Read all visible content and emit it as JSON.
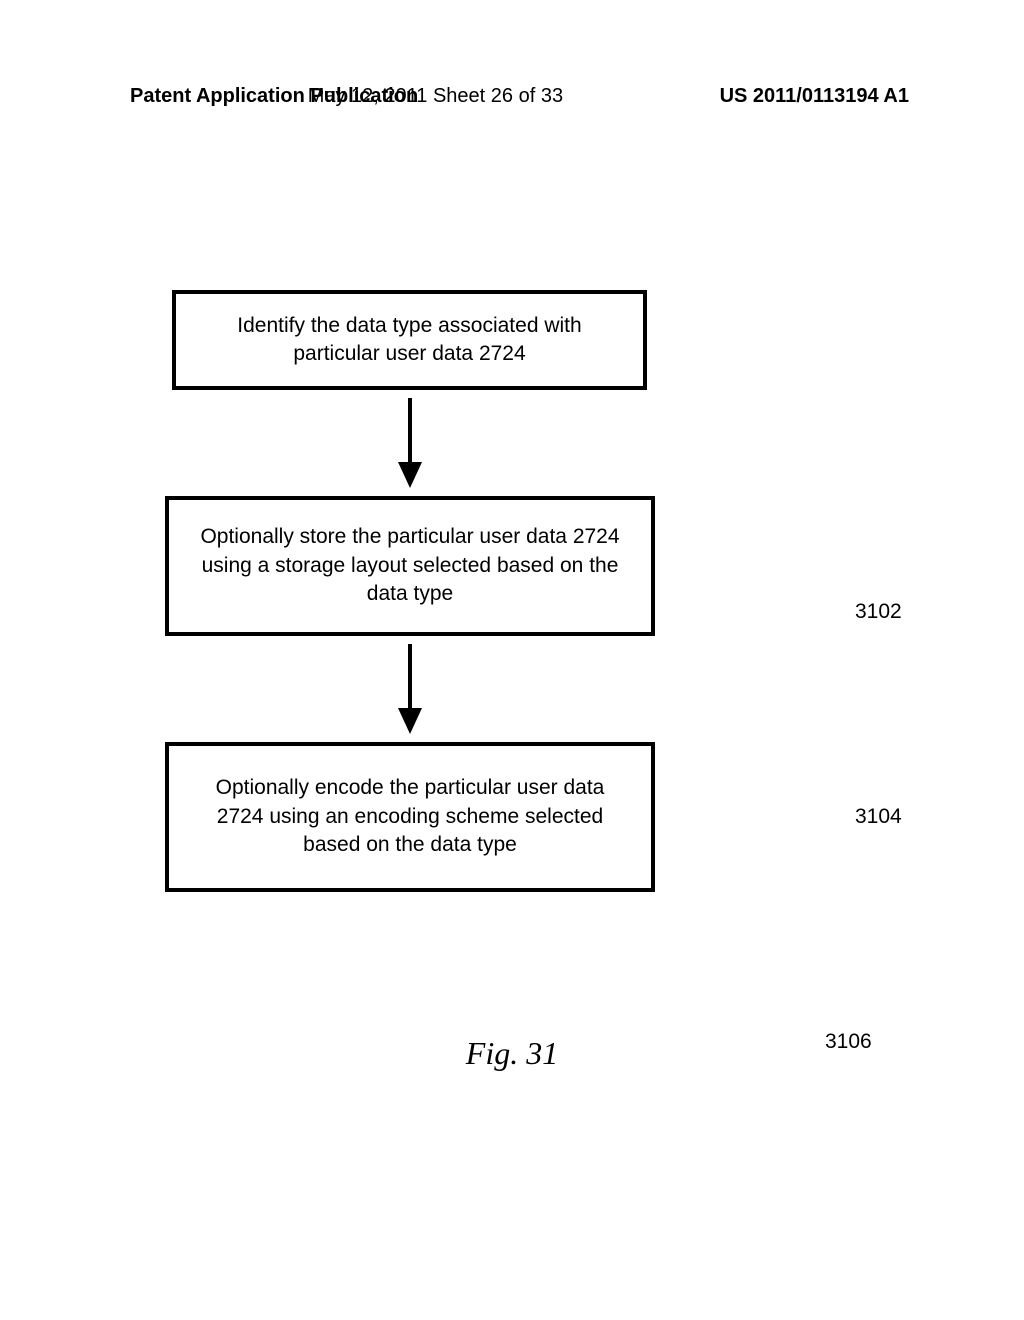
{
  "header": {
    "left": "Patent Application Publication",
    "center": "May 12, 2011  Sheet 26 of 33",
    "right": "US 2011/0113194 A1"
  },
  "flowchart": {
    "steps": [
      {
        "text": "Identify the data type associated with particular user data 2724",
        "ref": "3102"
      },
      {
        "text": "Optionally store the particular user data 2724 using a storage layout selected based on the data type",
        "ref": "3104"
      },
      {
        "text": "Optionally encode the particular user data 2724 using an encoding scheme selected based on the data type",
        "ref": "3106"
      }
    ]
  },
  "caption": "Fig. 31"
}
